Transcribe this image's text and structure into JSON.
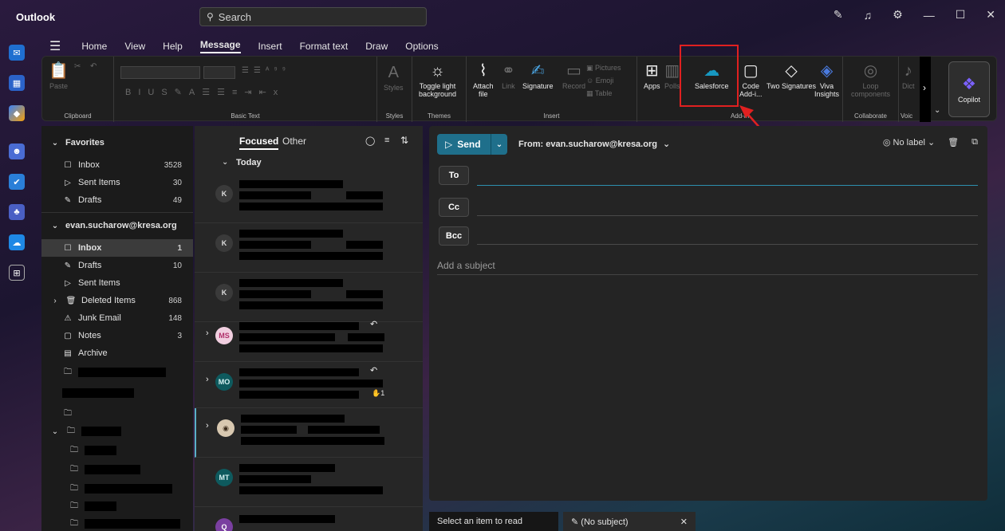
{
  "app": {
    "title": "Outlook"
  },
  "search": {
    "label": "Search"
  },
  "ribbon_tabs": [
    "Home",
    "View",
    "Help",
    "Message",
    "Insert",
    "Format text",
    "Draw",
    "Options"
  ],
  "ribbon": {
    "clipboard": {
      "label": "Clipboard",
      "paste": "Paste"
    },
    "basic_text": {
      "label": "Basic Text"
    },
    "styles": {
      "label": "Styles",
      "btn": "Styles"
    },
    "themes": {
      "label": "Themes",
      "btn1": "Toggle light",
      "btn2": "background"
    },
    "insert": {
      "label": "Insert",
      "attach1": "Attach",
      "attach2": "file",
      "link": "Link",
      "signature": "Signature",
      "record": "Record",
      "pictures": "Pictures",
      "emoji": "Emoji",
      "table": "Table"
    },
    "addins": {
      "label": "Add-in",
      "apps": "Apps",
      "polls": "Polls",
      "salesforce": "Salesforce",
      "code1": "Code",
      "code2": "Add-i...",
      "twosig": "Two Signatures",
      "viva1": "Viva",
      "viva2": "Insights"
    },
    "collaborate": {
      "label": "Collaborate",
      "loop1": "Loop",
      "loop2": "components"
    },
    "voice": {
      "label": "Voic",
      "dictate": "Dict"
    },
    "copilot": "Copilot"
  },
  "folders": {
    "favorites": "Favorites",
    "fav_items": [
      {
        "label": "Inbox",
        "count": "3528"
      },
      {
        "label": "Sent Items",
        "count": "30"
      },
      {
        "label": "Drafts",
        "count": "49"
      }
    ],
    "account": "evan.sucharow@kresa.org",
    "acct_items": [
      {
        "label": "Inbox",
        "count": "1"
      },
      {
        "label": "Drafts",
        "count": "10"
      },
      {
        "label": "Sent Items",
        "count": ""
      },
      {
        "label": "Deleted Items",
        "count": "868"
      },
      {
        "label": "Junk Email",
        "count": "148"
      },
      {
        "label": "Notes",
        "count": "3"
      },
      {
        "label": "Archive",
        "count": ""
      }
    ]
  },
  "message_list": {
    "tabs": {
      "focused": "Focused",
      "other": "Other"
    },
    "today": "Today",
    "avatars": [
      "K",
      "K",
      "K",
      "MS",
      "MO",
      "",
      "MT",
      "Q"
    ],
    "reaction": "1"
  },
  "compose": {
    "send": "Send",
    "from": "From: evan.sucharow@kresa.org",
    "no_label": "No label",
    "to": "To",
    "cc": "Cc",
    "bcc": "Bcc",
    "subject_placeholder": "Add a subject"
  },
  "bottom": {
    "read": "Select an item to read",
    "draft": "(No subject)"
  }
}
